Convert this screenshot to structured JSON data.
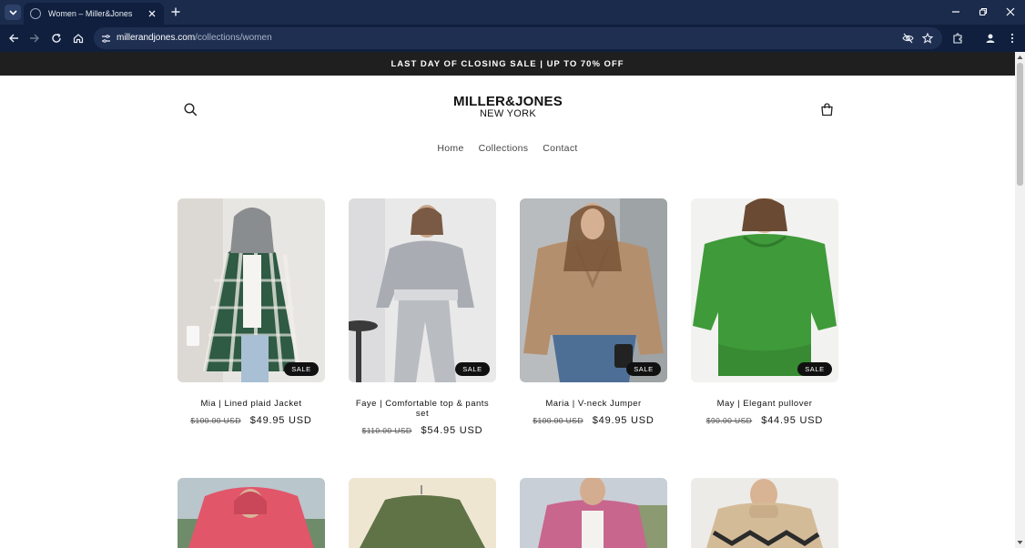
{
  "browser": {
    "tab_title": "Women – Miller&Jones",
    "url_host": "millerandjones.com",
    "url_path": "/collections/women"
  },
  "announcement": "LAST DAY OF CLOSING SALE | UP TO 70% OFF",
  "logo": {
    "line1": "MILLER&JONES",
    "line2": "NEW YORK"
  },
  "nav": [
    {
      "label": "Home"
    },
    {
      "label": "Collections"
    },
    {
      "label": "Contact"
    }
  ],
  "sale_label": "SALE",
  "products": [
    {
      "title": "Mia | Lined plaid Jacket",
      "old_price": "$100.00 USD",
      "new_price": "$49.95 USD"
    },
    {
      "title": "Faye | Comfortable top & pants set",
      "old_price": "$110.00 USD",
      "new_price": "$54.95 USD"
    },
    {
      "title": "Maria | V-neck Jumper",
      "old_price": "$100.00 USD",
      "new_price": "$49.95 USD"
    },
    {
      "title": "May | Elegant pullover",
      "old_price": "$90.00 USD",
      "new_price": "$44.95 USD"
    }
  ],
  "colors": {
    "tabbar": "#1a2b4c",
    "toolbar": "#0f1f3d",
    "announcement_bg": "#1f1f1f",
    "sale_badge": "#111111"
  }
}
